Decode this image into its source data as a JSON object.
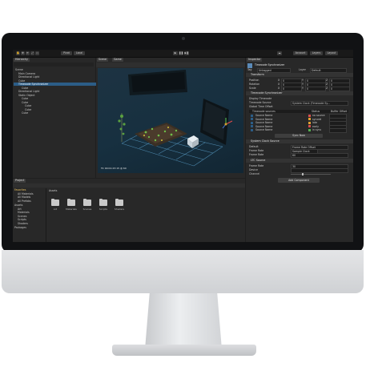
{
  "toolbar": {
    "center_label": "",
    "account": "Account",
    "layers": "Layers",
    "layout": "Layout"
  },
  "hierarchy": {
    "tab": "Hierarchy",
    "items": [
      {
        "label": "Scene"
      },
      {
        "label": "Main Camera"
      },
      {
        "label": "Directional Light"
      },
      {
        "label": "Cube"
      },
      {
        "label": "Timecode Synchronizer"
      },
      {
        "label": "Cube"
      },
      {
        "label": "Directional Light"
      },
      {
        "label": "Static Object"
      },
      {
        "label": "Cube"
      },
      {
        "label": "Cube"
      },
      {
        "label": "Cube"
      },
      {
        "label": "Cube"
      },
      {
        "label": "Cube"
      }
    ]
  },
  "scene": {
    "tabs": [
      "Scene",
      "Game"
    ],
    "overlay_text": "TC 00:01:23:15 @ 60"
  },
  "inspector": {
    "tab": "Inspector",
    "object_name": "Timecode Synchronizer",
    "tag_label": "Tag",
    "tag_value": "Untagged",
    "layer_label": "Layer",
    "layer_value": "Default",
    "transform": {
      "title": "Transform",
      "rows": [
        "Position",
        "Rotation",
        "Scale"
      ],
      "values": [
        "0",
        "0",
        "0"
      ]
    },
    "sync": {
      "title": "Timecode Synchronizer",
      "rows": [
        "Display Timecode",
        "Timecode Source",
        "Global Time Offset"
      ],
      "source_value": "System Clock (Timecode Sy...",
      "table_headers": [
        "Timecode sources",
        "Status",
        "Buffer Offset"
      ],
      "sources": [
        {
          "name": "Source Name",
          "status": "no source",
          "color": "#d94f4f"
        },
        {
          "name": "Source Name",
          "status": "synced",
          "color": "#e0a030"
        },
        {
          "name": "Source Name",
          "status": "late",
          "color": "#e0a030"
        },
        {
          "name": "Source Name",
          "status": "early",
          "color": "#d94f4f"
        },
        {
          "name": "Source Name",
          "status": "in sync",
          "color": "#55b050"
        }
      ],
      "button": "Sync Now"
    },
    "clock": {
      "title": "System Clock Source",
      "rows": [
        "Default",
        "Frame Rate",
        "Frame Rate"
      ],
      "values": [
        "Frame Rate Offset",
        "Sample Clock",
        "60"
      ]
    },
    "ltc": {
      "title": "LTC Source",
      "rows": [
        "Frame Rate",
        "Device",
        "Channel"
      ],
      "values": [
        "30",
        "",
        ""
      ]
    },
    "add_component": "Add Component"
  },
  "project": {
    "tab": "Project",
    "favorites": "Favorites",
    "fav_items": [
      "All Materials",
      "All Models",
      "All Prefabs"
    ],
    "assets": "Assets",
    "asset_items": [
      "Art",
      "Materials",
      "Scenes",
      "Scripts",
      "Shaders"
    ],
    "packages": "Packages",
    "breadcrumb": "Assets",
    "folders": [
      "Art",
      "Materials",
      "Scenes",
      "Scripts",
      "Shaders"
    ]
  },
  "colors": {
    "accent": "#2c5d87",
    "scene_bg": "#1a2e3c"
  }
}
